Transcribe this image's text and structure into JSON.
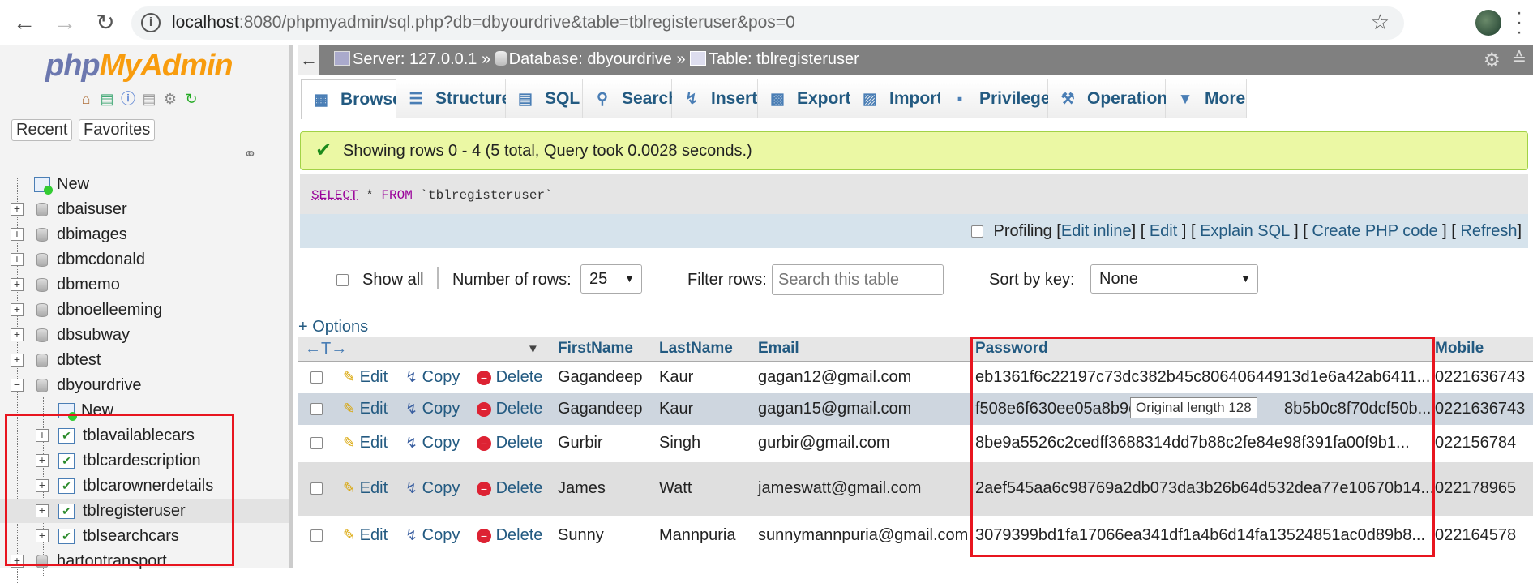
{
  "browser": {
    "url_host": "localhost",
    "url_rest": ":8080/phpmyadmin/sql.php?db=dbyourdrive&table=tblregisteruser&pos=0",
    "info_glyph": "i"
  },
  "app": {
    "logo_part1": "php",
    "logo_part2": "MyAdmin",
    "recent_label": "Recent",
    "favorites_label": "Favorites"
  },
  "tree": {
    "new_label": "New",
    "databases": [
      "dbaisuser",
      "dbimages",
      "dbmcdonald",
      "dbmemo",
      "dbnoelleeming",
      "dbsubway",
      "dbtest",
      "dbyourdrive"
    ],
    "expanded_new": "New",
    "tables": [
      "tblavailablecars",
      "tblcardescription",
      "tblcarownerdetails",
      "tblregisteruser",
      "tblsearchcars"
    ],
    "after": "hartontransport"
  },
  "breadcrumb": {
    "server": "Server: 127.0.0.1 »",
    "database": "Database: dbyourdrive »",
    "table": "Table: tblregisteruser"
  },
  "tabs": [
    "Browse",
    "Structure",
    "SQL",
    "Search",
    "Insert",
    "Export",
    "Import",
    "Privileges",
    "Operations",
    "More"
  ],
  "messages": {
    "success": "Showing rows 0 - 4 (5 total, Query took 0.0028 seconds.)",
    "sql_select": "SELECT",
    "sql_star": " * ",
    "sql_from": "FROM",
    "sql_table": " `tblregisteruser`"
  },
  "profiling": {
    "label": "Profiling",
    "edit_inline": "Edit inline",
    "edit": "Edit",
    "explain": "Explain SQL",
    "create_php": "Create PHP code",
    "refresh": "Refresh"
  },
  "nav": {
    "show_all": "Show all",
    "num_rows_label": "Number of rows:",
    "num_rows_value": "25",
    "filter_label": "Filter rows:",
    "filter_placeholder": "Search this table",
    "sort_label": "Sort by key:",
    "sort_value": "None",
    "options": "+ Options"
  },
  "table": {
    "columns": [
      "FirstName",
      "LastName",
      "Email",
      "Password",
      "Mobile"
    ],
    "actions": {
      "edit": "Edit",
      "copy": "Copy",
      "delete": "Delete"
    },
    "rows": [
      {
        "first": "Gagandeep",
        "last": "Kaur",
        "email": "gagan12@gmail.com",
        "password": "eb1361f6c22197c73dc382b45c80640644913d1e6a42ab6411...",
        "mobile": "0221636743"
      },
      {
        "first": "Gagandeep",
        "last": "Kaur",
        "email": "gagan15@gmail.com",
        "password": "f508e6f630ee05a8b9c",
        "password_tail": "8b5b0c8f70dcf50b...",
        "mobile": "0221636743"
      },
      {
        "first": "Gurbir",
        "last": "Singh",
        "email": "gurbir@gmail.com",
        "password": "8be9a5526c2cedff3688314dd7b88c2fe84e98f391fa00f9b1...",
        "mobile": "022156784"
      },
      {
        "first": "James",
        "last": "Watt",
        "email": "jameswatt@gmail.com",
        "password": "2aef545aa6c98769a2db073da3b26b64d532dea77e10670b14...",
        "mobile": "022178965"
      },
      {
        "first": "Sunny",
        "last": "Mannpuria",
        "email": "sunnymannpuria@gmail.com",
        "password": "3079399bd1fa17066ea341df1a4b6d14fa13524851ac0d89b8...",
        "mobile": "022164578"
      }
    ],
    "tooltip": "Original length 128"
  },
  "colors": {
    "link": "#235a81",
    "success_bg": "#ebf8a4",
    "highlight": "#e8151f",
    "logo_blue": "#6c78af",
    "logo_orange": "#f89c0e"
  }
}
